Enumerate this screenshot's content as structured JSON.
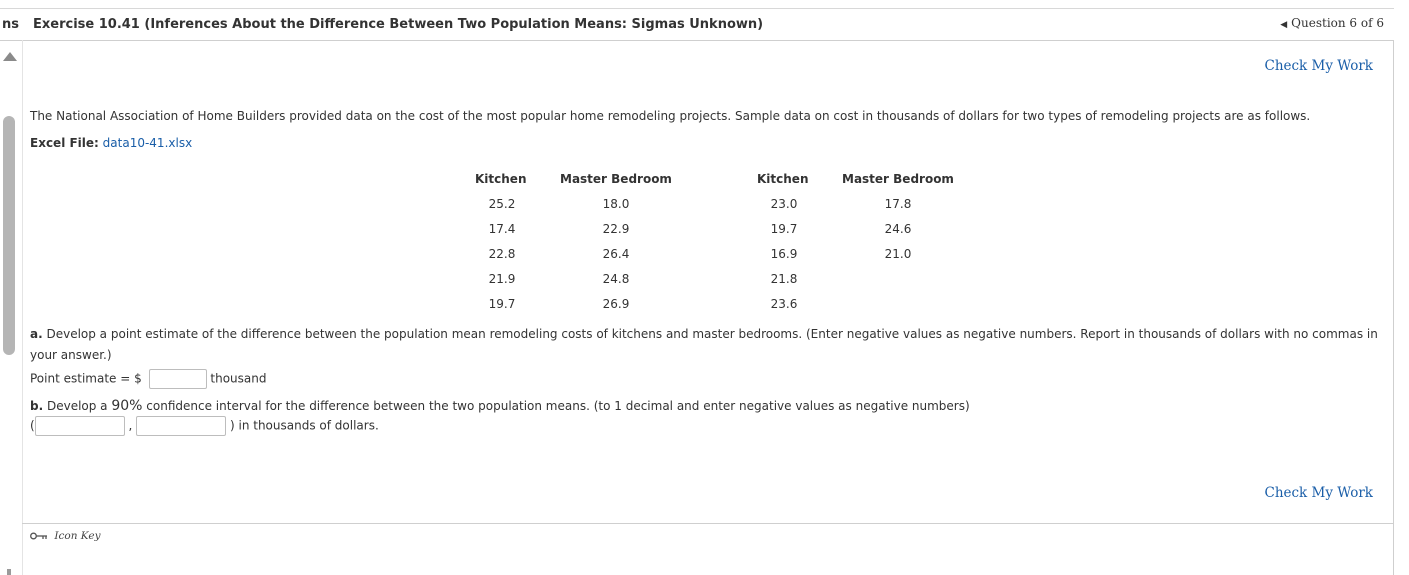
{
  "header": {
    "cut_text": "ns",
    "title": "Exercise 10.41 (Inferences About the Difference Between Two Population Means: Sigmas Unknown)",
    "question_nav": "Question 6 of 6"
  },
  "check_my_work": "Check My Work",
  "intro": "The National Association of Home Builders provided data on the cost of the most popular home remodeling projects. Sample data on cost in thousands of dollars for two types of remodeling projects are as follows.",
  "excel": {
    "label": "Excel File:",
    "file": "data10-41.xlsx"
  },
  "table": {
    "headers": [
      "Kitchen",
      "Master Bedroom",
      "Kitchen",
      "Master Bedroom"
    ],
    "col1": [
      "25.2",
      "17.4",
      "22.8",
      "21.9",
      "19.7"
    ],
    "col2": [
      "18.0",
      "22.9",
      "26.4",
      "24.8",
      "26.9"
    ],
    "col3": [
      "23.0",
      "19.7",
      "16.9",
      "21.8",
      "23.6"
    ],
    "col4": [
      "17.8",
      "24.6",
      "21.0"
    ]
  },
  "part_a": {
    "label": "a.",
    "text_line1": " Develop a point estimate of the difference between the population mean remodeling costs of kitchens and master bedrooms. (Enter negative values as negative numbers. Report in thousands of dollars with no commas in",
    "text_line2": "your answer.)",
    "point_label": "Point estimate = $",
    "point_value": "",
    "unit": "thousand"
  },
  "part_b": {
    "label": "b.",
    "text_pre": " Develop a ",
    "percent": "90%",
    "text_post": " confidence interval for the difference between the two population means. (to 1 decimal and enter negative values as negative numbers)",
    "open_paren": "(",
    "comma": ",",
    "lower_value": "",
    "upper_value": "",
    "suffix": ") in thousands of dollars."
  },
  "footer": {
    "icon_key_label": "Icon Key"
  },
  "colors": {
    "link": "#1a5ea8",
    "text": "#333333",
    "border": "#cfcfcf"
  }
}
